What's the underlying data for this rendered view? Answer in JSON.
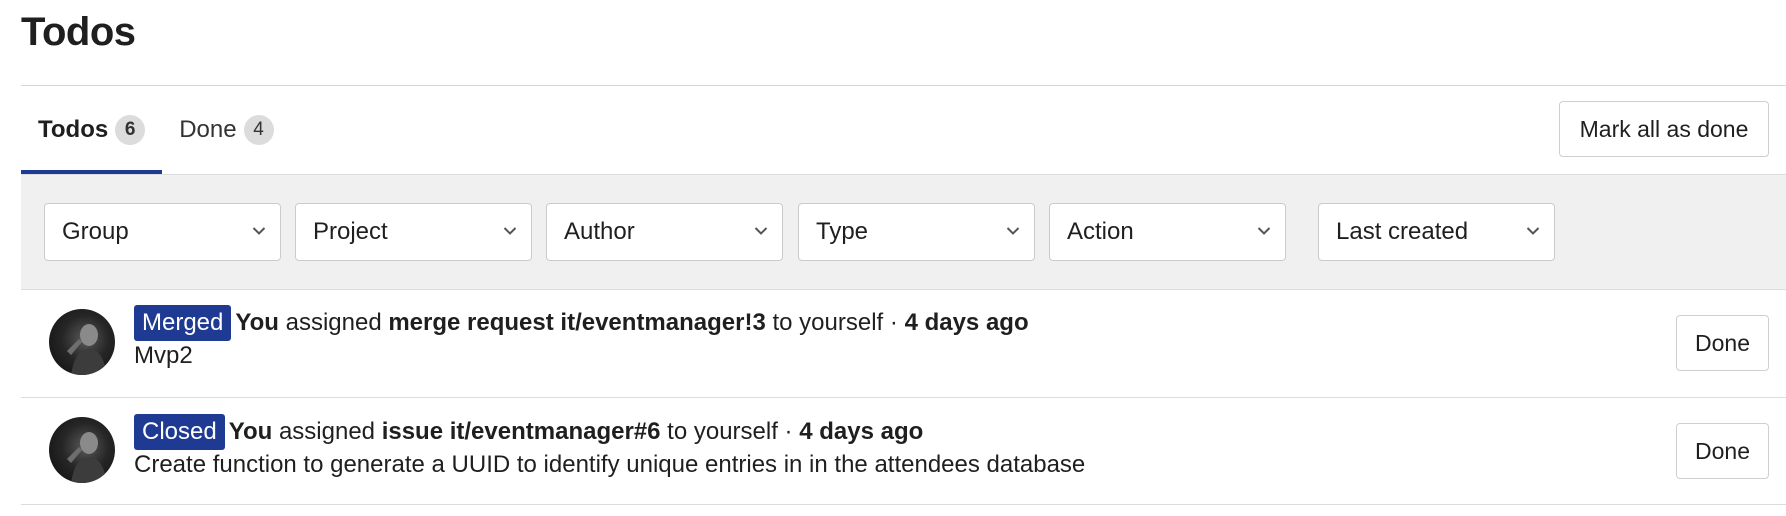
{
  "page_title": "Todos",
  "tabs": [
    {
      "label": "Todos",
      "count": "6"
    },
    {
      "label": "Done",
      "count": "4"
    }
  ],
  "mark_all_label": "Mark all as done",
  "filters": {
    "group": "Group",
    "project": "Project",
    "author": "Author",
    "type": "Type",
    "action": "Action",
    "sort": "Last created"
  },
  "todos": [
    {
      "state": "Merged",
      "actor": "You",
      "verb": "assigned",
      "target": "merge request it/eventmanager!3",
      "suffix": "to yourself ·",
      "time": "4 days ago",
      "body": "Mvp2",
      "done_label": "Done"
    },
    {
      "state": "Closed",
      "actor": "You",
      "verb": "assigned",
      "target": "issue it/eventmanager#6",
      "suffix": "to yourself ·",
      "time": "4 days ago",
      "body": "Create function to generate a UUID to identify unique entries in in the attendees database",
      "done_label": "Done"
    }
  ],
  "colors": {
    "accent": "#1f3a93",
    "badge_text": "#ffffff",
    "filter_bg": "#f0f0f0",
    "count_bg": "#dcdcdc"
  },
  "icons": {
    "dropdown": "chevron-down-icon",
    "avatar": "user-avatar"
  }
}
